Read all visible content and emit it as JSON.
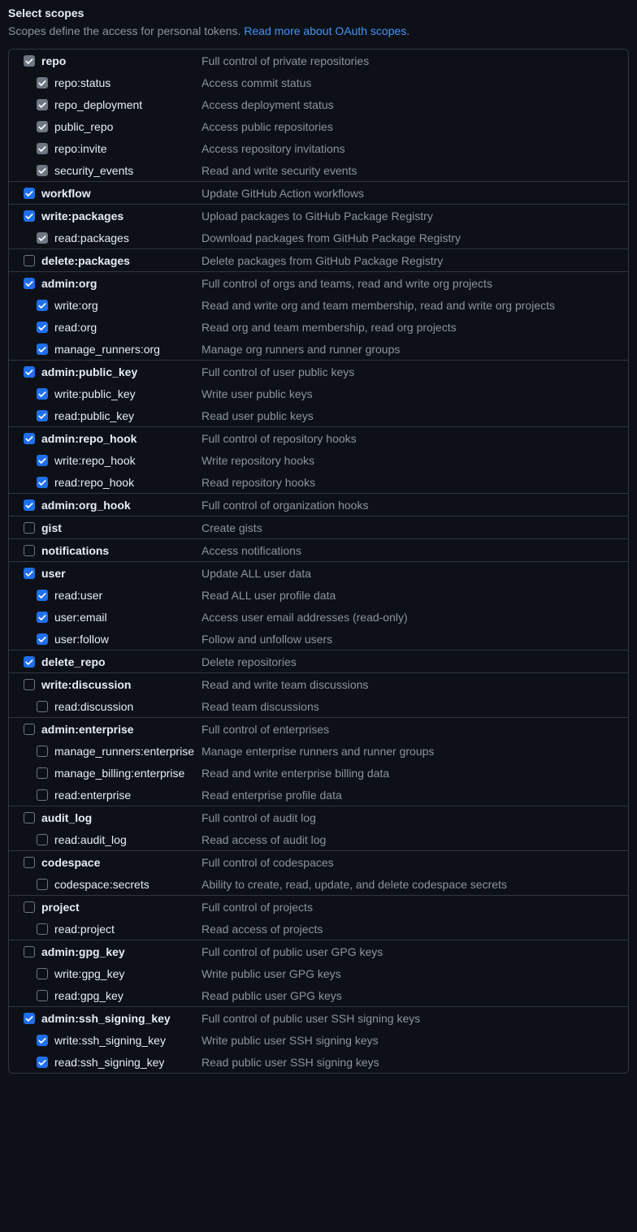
{
  "header": {
    "title": "Select scopes",
    "desc_prefix": "Scopes define the access for personal tokens. ",
    "link_text": "Read more about OAuth scopes",
    "desc_suffix": "."
  },
  "groups": [
    {
      "parent": {
        "name": "repo",
        "desc": "Full control of private repositories",
        "checked": true,
        "implied": true
      },
      "children": [
        {
          "name": "repo:status",
          "desc": "Access commit status",
          "checked": true,
          "implied": true
        },
        {
          "name": "repo_deployment",
          "desc": "Access deployment status",
          "checked": true,
          "implied": true
        },
        {
          "name": "public_repo",
          "desc": "Access public repositories",
          "checked": true,
          "implied": true
        },
        {
          "name": "repo:invite",
          "desc": "Access repository invitations",
          "checked": true,
          "implied": true
        },
        {
          "name": "security_events",
          "desc": "Read and write security events",
          "checked": true,
          "implied": true
        }
      ]
    },
    {
      "parent": {
        "name": "workflow",
        "desc": "Update GitHub Action workflows",
        "checked": true
      },
      "children": []
    },
    {
      "parent": {
        "name": "write:packages",
        "desc": "Upload packages to GitHub Package Registry",
        "checked": true
      },
      "children": [
        {
          "name": "read:packages",
          "desc": "Download packages from GitHub Package Registry",
          "checked": true,
          "implied": true
        }
      ]
    },
    {
      "parent": {
        "name": "delete:packages",
        "desc": "Delete packages from GitHub Package Registry",
        "checked": false
      },
      "children": []
    },
    {
      "parent": {
        "name": "admin:org",
        "desc": "Full control of orgs and teams, read and write org projects",
        "checked": true
      },
      "children": [
        {
          "name": "write:org",
          "desc": "Read and write org and team membership, read and write org projects",
          "checked": true
        },
        {
          "name": "read:org",
          "desc": "Read org and team membership, read org projects",
          "checked": true
        },
        {
          "name": "manage_runners:org",
          "desc": "Manage org runners and runner groups",
          "checked": true
        }
      ]
    },
    {
      "parent": {
        "name": "admin:public_key",
        "desc": "Full control of user public keys",
        "checked": true
      },
      "children": [
        {
          "name": "write:public_key",
          "desc": "Write user public keys",
          "checked": true
        },
        {
          "name": "read:public_key",
          "desc": "Read user public keys",
          "checked": true
        }
      ]
    },
    {
      "parent": {
        "name": "admin:repo_hook",
        "desc": "Full control of repository hooks",
        "checked": true
      },
      "children": [
        {
          "name": "write:repo_hook",
          "desc": "Write repository hooks",
          "checked": true
        },
        {
          "name": "read:repo_hook",
          "desc": "Read repository hooks",
          "checked": true
        }
      ]
    },
    {
      "parent": {
        "name": "admin:org_hook",
        "desc": "Full control of organization hooks",
        "checked": true
      },
      "children": []
    },
    {
      "parent": {
        "name": "gist",
        "desc": "Create gists",
        "checked": false
      },
      "children": []
    },
    {
      "parent": {
        "name": "notifications",
        "desc": "Access notifications",
        "checked": false
      },
      "children": []
    },
    {
      "parent": {
        "name": "user",
        "desc": "Update ALL user data",
        "checked": true
      },
      "children": [
        {
          "name": "read:user",
          "desc": "Read ALL user profile data",
          "checked": true
        },
        {
          "name": "user:email",
          "desc": "Access user email addresses (read-only)",
          "checked": true
        },
        {
          "name": "user:follow",
          "desc": "Follow and unfollow users",
          "checked": true
        }
      ]
    },
    {
      "parent": {
        "name": "delete_repo",
        "desc": "Delete repositories",
        "checked": true
      },
      "children": []
    },
    {
      "parent": {
        "name": "write:discussion",
        "desc": "Read and write team discussions",
        "checked": false
      },
      "children": [
        {
          "name": "read:discussion",
          "desc": "Read team discussions",
          "checked": false
        }
      ]
    },
    {
      "parent": {
        "name": "admin:enterprise",
        "desc": "Full control of enterprises",
        "checked": false
      },
      "children": [
        {
          "name": "manage_runners:enterprise",
          "desc": "Manage enterprise runners and runner groups",
          "checked": false
        },
        {
          "name": "manage_billing:enterprise",
          "desc": "Read and write enterprise billing data",
          "checked": false
        },
        {
          "name": "read:enterprise",
          "desc": "Read enterprise profile data",
          "checked": false
        }
      ]
    },
    {
      "parent": {
        "name": "audit_log",
        "desc": "Full control of audit log",
        "checked": false
      },
      "children": [
        {
          "name": "read:audit_log",
          "desc": "Read access of audit log",
          "checked": false
        }
      ]
    },
    {
      "parent": {
        "name": "codespace",
        "desc": "Full control of codespaces",
        "checked": false
      },
      "children": [
        {
          "name": "codespace:secrets",
          "desc": "Ability to create, read, update, and delete codespace secrets",
          "checked": false
        }
      ]
    },
    {
      "parent": {
        "name": "project",
        "desc": "Full control of projects",
        "checked": false
      },
      "children": [
        {
          "name": "read:project",
          "desc": "Read access of projects",
          "checked": false
        }
      ]
    },
    {
      "parent": {
        "name": "admin:gpg_key",
        "desc": "Full control of public user GPG keys",
        "checked": false
      },
      "children": [
        {
          "name": "write:gpg_key",
          "desc": "Write public user GPG keys",
          "checked": false
        },
        {
          "name": "read:gpg_key",
          "desc": "Read public user GPG keys",
          "checked": false
        }
      ]
    },
    {
      "parent": {
        "name": "admin:ssh_signing_key",
        "desc": "Full control of public user SSH signing keys",
        "checked": true
      },
      "children": [
        {
          "name": "write:ssh_signing_key",
          "desc": "Write public user SSH signing keys",
          "checked": true
        },
        {
          "name": "read:ssh_signing_key",
          "desc": "Read public user SSH signing keys",
          "checked": true
        }
      ]
    }
  ]
}
